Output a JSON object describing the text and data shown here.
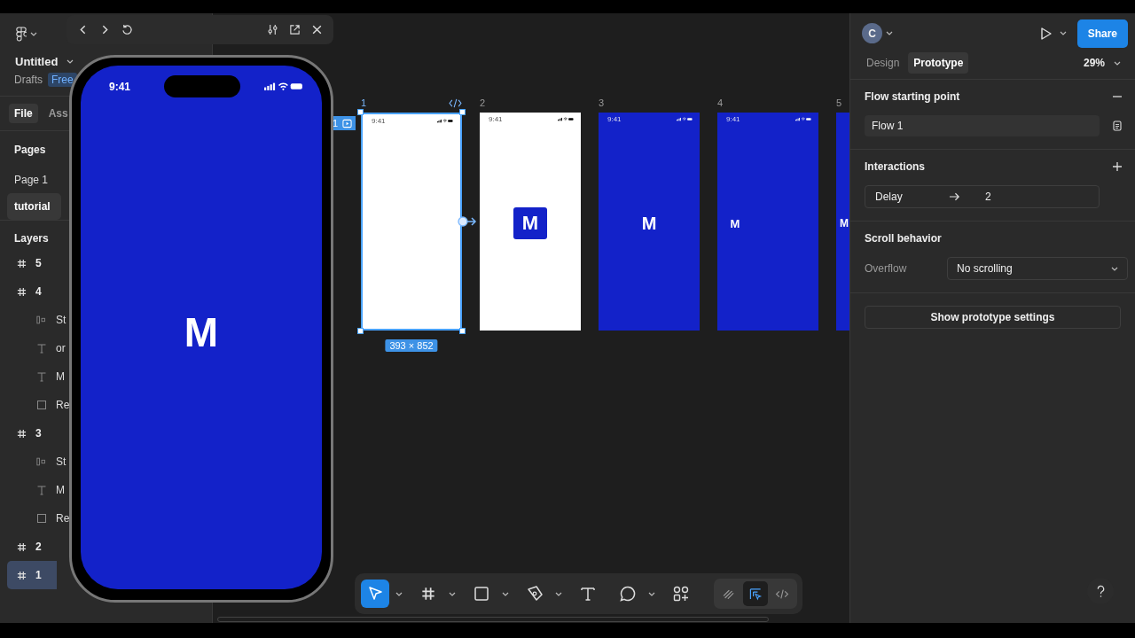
{
  "file": {
    "title": "Untitled",
    "location": "Drafts",
    "plan_badge": "Free"
  },
  "sidebar_tabs": [
    {
      "label": "File",
      "selected": true
    },
    {
      "label": "Ass",
      "selected": false
    }
  ],
  "pages": {
    "heading": "Pages",
    "items": [
      {
        "label": "Page 1",
        "selected": false
      },
      {
        "label": "tutorial",
        "selected": true
      }
    ]
  },
  "layers": {
    "heading": "Layers",
    "items": [
      {
        "kind": "frame",
        "name": "5",
        "selected": false
      },
      {
        "kind": "frame",
        "name": "4",
        "selected": false,
        "children": [
          {
            "kind": "stack",
            "name": "St",
            "selected": false
          },
          {
            "kind": "text",
            "name": "or",
            "selected": false
          },
          {
            "kind": "text",
            "name": "M",
            "selected": false
          },
          {
            "kind": "rectangle",
            "name": "Re",
            "selected": false
          }
        ]
      },
      {
        "kind": "frame",
        "name": "3",
        "selected": false,
        "children": [
          {
            "kind": "stack",
            "name": "St",
            "selected": false
          },
          {
            "kind": "text",
            "name": "M",
            "selected": false
          },
          {
            "kind": "rectangle",
            "name": "Re",
            "selected": false
          }
        ]
      },
      {
        "kind": "frame",
        "name": "2",
        "selected": false
      },
      {
        "kind": "frame",
        "name": "1",
        "selected": true
      }
    ]
  },
  "preview": {
    "time": "9:41",
    "logo": "M"
  },
  "canvas": {
    "flow_badge": "1",
    "size_label": "393 × 852",
    "frames": [
      {
        "label": "1",
        "kind": "white_blank",
        "time": "9:41",
        "selected": true
      },
      {
        "label": "2",
        "kind": "white_logo",
        "time": "9:41",
        "logo": "M",
        "selected": false
      },
      {
        "label": "3",
        "kind": "blue_large",
        "time": "9:41",
        "logo": "M",
        "selected": false
      },
      {
        "label": "4",
        "kind": "blue_small",
        "time": "9:41",
        "logo": "M",
        "selected": false
      },
      {
        "label": "5",
        "kind": "blue_edge",
        "logo": "M",
        "selected": false
      }
    ]
  },
  "toolbar": {
    "tools": [
      {
        "kind": "move",
        "selected": true,
        "menu": true
      },
      {
        "kind": "frame",
        "selected": false,
        "menu": true
      },
      {
        "kind": "rectangle",
        "selected": false,
        "menu": true
      },
      {
        "kind": "pen",
        "selected": false,
        "menu": true
      },
      {
        "kind": "text",
        "selected": false,
        "menu": false
      },
      {
        "kind": "comment",
        "selected": false,
        "menu": true
      },
      {
        "kind": "actions",
        "selected": false,
        "menu": false
      }
    ],
    "modes": [
      {
        "kind": "draw",
        "selected": false
      },
      {
        "kind": "design",
        "selected": true
      },
      {
        "kind": "dev",
        "selected": false
      }
    ]
  },
  "header": {
    "avatar": "C",
    "share": "Share"
  },
  "panel_tabs": [
    {
      "label": "Design",
      "selected": false
    },
    {
      "label": "Prototype",
      "selected": true
    }
  ],
  "zoom": "29%",
  "flow": {
    "heading": "Flow starting point",
    "name": "Flow 1"
  },
  "interactions": {
    "heading": "Interactions",
    "items": [
      {
        "trigger": "Delay",
        "target": "2"
      }
    ]
  },
  "scroll": {
    "heading": "Scroll behavior",
    "label": "Overflow",
    "value": "No scrolling"
  },
  "settings_button": "Show prototype settings"
}
